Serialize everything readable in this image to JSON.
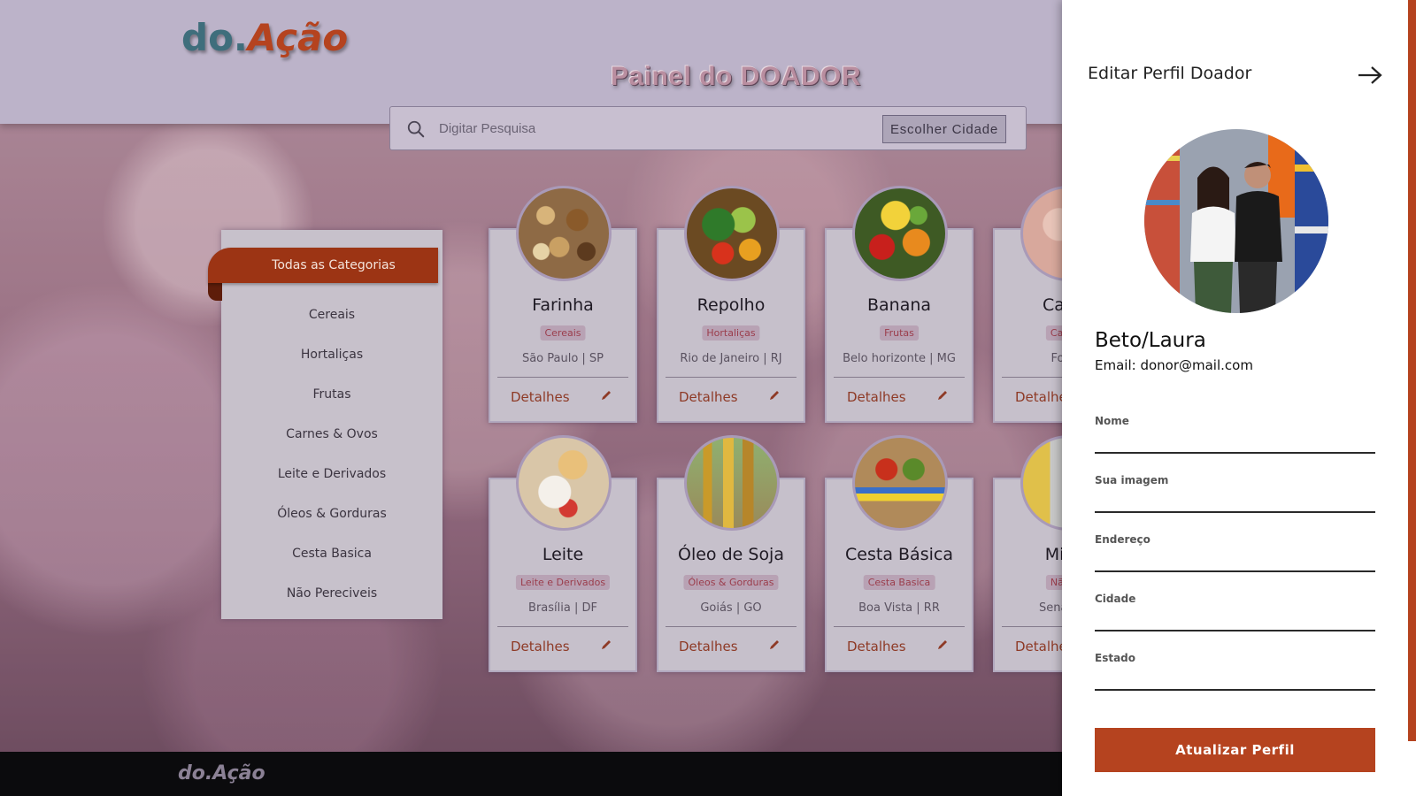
{
  "header": {
    "logo_part1": "do.",
    "logo_part2": "Ação",
    "title": "Painel do DOADOR",
    "search_placeholder": "Digitar Pesquisa",
    "city_button": "Escolher Cidade"
  },
  "sidebar": {
    "active": "Todas as Categorias",
    "items": [
      "Cereais",
      "Hortaliças",
      "Frutas",
      "Carnes & Ovos",
      "Leite e Derivados",
      "Óleos & Gorduras",
      "Cesta Basica",
      "Não Pereciveis"
    ]
  },
  "cards": [
    {
      "title": "Farinha",
      "tag": "Cereais",
      "location": "São Paulo | SP",
      "link": "Detalhes",
      "icon": "grain-sacks-image"
    },
    {
      "title": "Repolho",
      "tag": "Hortaliças",
      "location": "Rio de Janeiro | RJ",
      "link": "Detalhes",
      "icon": "vegetable-basket-image"
    },
    {
      "title": "Banana",
      "tag": "Frutas",
      "location": "Belo horizonte | MG",
      "link": "Detalhes",
      "icon": "fruits-image"
    },
    {
      "title": "Carne",
      "tag": "Carnes",
      "location": "Fortal",
      "link": "Detalhe",
      "icon": "meat-image"
    },
    {
      "title": "Leite",
      "tag": "Leite e Derivados",
      "location": "Brasília | DF",
      "link": "Detalhes",
      "icon": "dairy-image"
    },
    {
      "title": "Óleo de Soja",
      "tag": "Óleos & Gorduras",
      "location": "Goiás | GO",
      "link": "Detalhes",
      "icon": "oil-bottles-image"
    },
    {
      "title": "Cesta Básica",
      "tag": "Cesta Basica",
      "location": "Boa Vista | RR",
      "link": "Detalhes",
      "icon": "food-box-image"
    },
    {
      "title": "Milho",
      "tag": "Não Pe",
      "location": "Sena Mad",
      "link": "Detalhe",
      "icon": "canned-goods-image"
    }
  ],
  "footer": {
    "logo": "do.Ação"
  },
  "drawer": {
    "title": "Editar Perfil Doador",
    "name": "Beto/Laura",
    "email": "Email: donor@mail.com",
    "fields": [
      "Nome",
      "Sua imagem",
      "Endereço",
      "Cidade",
      "Estado"
    ],
    "button": "Atualizar Perfil"
  },
  "colors": {
    "accent": "#b5431f",
    "footer": "#0b0b0d",
    "header": "#bcb3c9"
  }
}
